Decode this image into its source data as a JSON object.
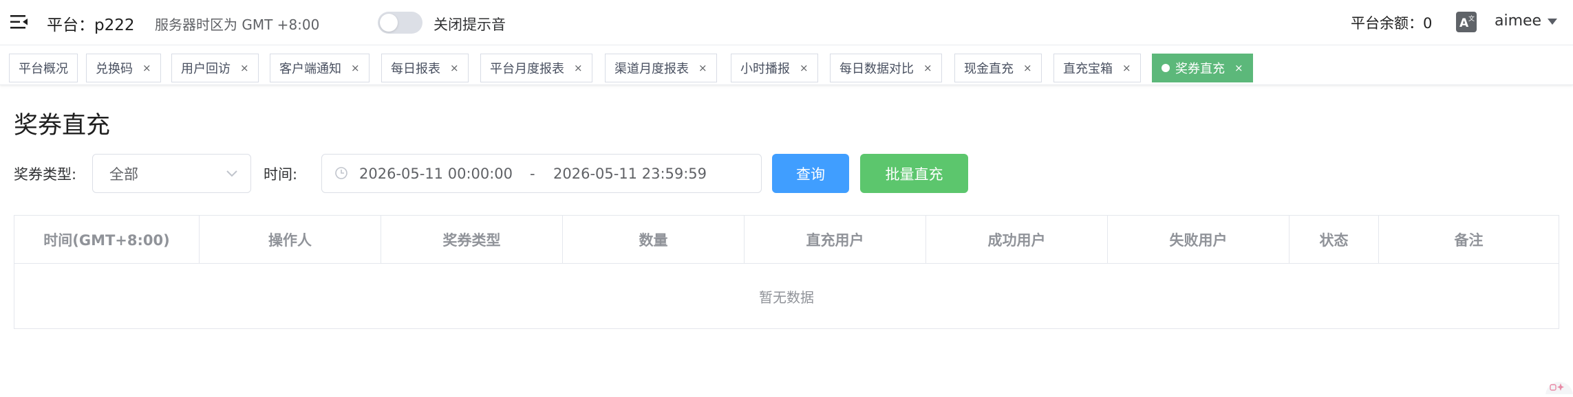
{
  "header": {
    "platform": "平台：p222",
    "timezone": "服务器时区为 GMT +8:00",
    "sound_toggle_label": "关闭提示音",
    "sound_toggle_on": false,
    "balance": "平台余额：0",
    "translate_icon": "translate-icon",
    "username": "aimee"
  },
  "tags": [
    {
      "label": "平台概况",
      "closable": false,
      "active": false
    },
    {
      "label": "兑换码",
      "closable": true,
      "active": false
    },
    {
      "label": "用户回访",
      "closable": true,
      "active": false
    },
    {
      "label": "客户端通知",
      "closable": true,
      "active": false
    },
    {
      "label": "每日报表",
      "closable": true,
      "active": false
    },
    {
      "label": "平台月度报表",
      "closable": true,
      "active": false
    },
    {
      "label": "渠道月度报表",
      "closable": true,
      "active": false
    },
    {
      "label": "小时播报",
      "closable": true,
      "active": false
    },
    {
      "label": "每日数据对比",
      "closable": true,
      "active": false
    },
    {
      "label": "现金直充",
      "closable": true,
      "active": false
    },
    {
      "label": "直充宝箱",
      "closable": true,
      "active": false
    },
    {
      "label": "奖券直充",
      "closable": true,
      "active": true
    }
  ],
  "tag_close_glyph": "×",
  "page": {
    "title": "奖券直充"
  },
  "filters": {
    "type_label": "奖券类型:",
    "type_value": "全部",
    "time_label": "时间:",
    "start_time": "2026-05-11 00:00:00",
    "separator": "-",
    "end_time": "2026-05-11 23:59:59",
    "query_button": "查询",
    "batch_button": "批量直充"
  },
  "table": {
    "columns": [
      "时间(GMT+8:00)",
      "操作人",
      "奖券类型",
      "数量",
      "直充用户",
      "成功用户",
      "失败用户",
      "状态",
      "备注"
    ],
    "empty_text": "暂无数据"
  },
  "colors": {
    "primary": "#409eff",
    "success": "#5cc66d",
    "active_tag": "#5cb87a"
  }
}
